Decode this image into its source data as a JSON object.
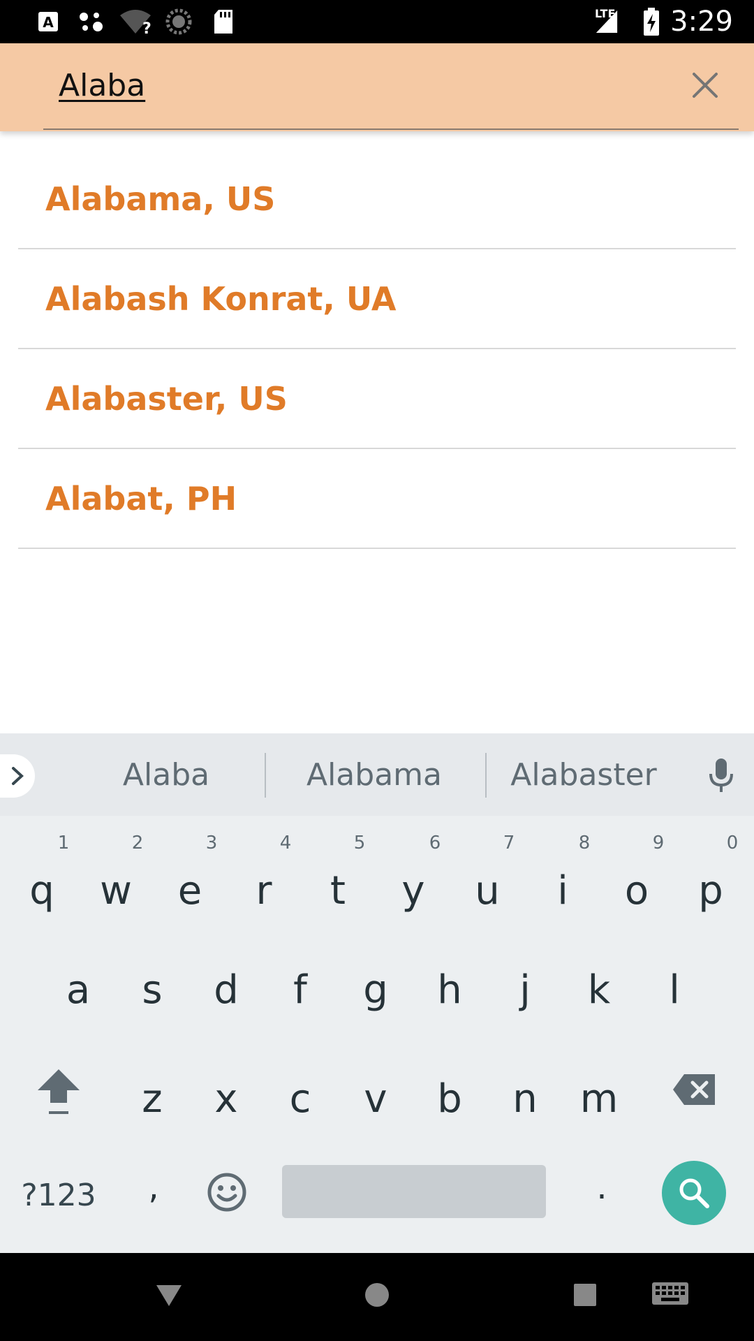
{
  "status_bar": {
    "time": "3:29",
    "network": "LTE",
    "icons": [
      "a-notification-icon",
      "assistant-icon",
      "wifi-unknown-icon",
      "loading-icon",
      "sd-card-icon",
      "signal-icon",
      "battery-charging-icon"
    ]
  },
  "search": {
    "query": "Alaba",
    "clear_icon": "close-icon"
  },
  "results": [
    {
      "label": "Alabama, US"
    },
    {
      "label": "Alabash Konrat, UA"
    },
    {
      "label": "Alabaster, US"
    },
    {
      "label": "Alabat, PH"
    }
  ],
  "keyboard": {
    "suggestions": [
      "Alaba",
      "Alabama",
      "Alabaster"
    ],
    "row1": [
      "q",
      "w",
      "e",
      "r",
      "t",
      "y",
      "u",
      "i",
      "o",
      "p"
    ],
    "row1_hints": [
      "1",
      "2",
      "3",
      "4",
      "5",
      "6",
      "7",
      "8",
      "9",
      "0"
    ],
    "row2": [
      "a",
      "s",
      "d",
      "f",
      "g",
      "h",
      "j",
      "k",
      "l"
    ],
    "row3": [
      "z",
      "x",
      "c",
      "v",
      "b",
      "n",
      "m"
    ],
    "symbols_label": "?123",
    "comma": ",",
    "period": ".",
    "accent_color": "#3fb4a4"
  },
  "colors": {
    "header_bg": "#f5c9a4",
    "result_text": "#e07b28"
  }
}
